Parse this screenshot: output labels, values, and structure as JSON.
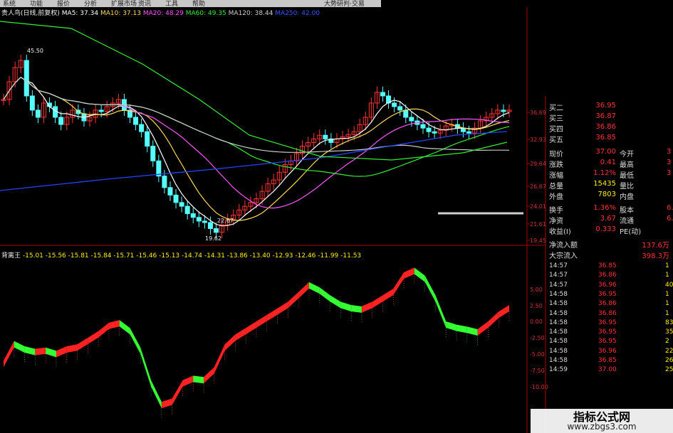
{
  "menu": [
    "系统",
    "功能",
    "报价",
    "分析",
    "扩展市场",
    "资讯",
    "工具",
    "帮助"
  ],
  "menu_right": "大势研判·交易",
  "header": {
    "title": "贵人鸟(日线,前复权)",
    "ma": [
      {
        "label": "MA5: 37.34",
        "color": "#ffffff"
      },
      {
        "label": "MA10: 37.13",
        "color": "#ffdd55"
      },
      {
        "label": "MA20: 48.29",
        "color": "#ff55ff"
      },
      {
        "label": "MA60: 49.35",
        "color": "#33ee33"
      },
      {
        "label": "MA120: 38.44",
        "color": "#cccccc"
      },
      {
        "label": "MA250: 42.00",
        "color": "#3355ff"
      }
    ]
  },
  "price_axis": [
    "36.69",
    "32.93",
    "29.64",
    "26.67",
    "24.01",
    "21.61",
    "19.45"
  ],
  "annotations": {
    "high": "45.50",
    "low": "19.62",
    "mid": "22.67"
  },
  "indicator": {
    "name": "背离王",
    "values": [
      "-15.01",
      "-15.56",
      "-15.81",
      "-15.84",
      "-15.71",
      "-15.46",
      "-15.13",
      "-14.74",
      "-14.31",
      "-13.86",
      "-13.40",
      "-12.93",
      "-12.46",
      "-11.99",
      "-11.53"
    ],
    "axis": [
      "5.00",
      "2.50",
      "0.00",
      "-2.50",
      "-5.00",
      "-7.50",
      "-10.00"
    ]
  },
  "panel": {
    "quotes": [
      {
        "label": "买二",
        "value": "36.95"
      },
      {
        "label": "买三",
        "value": "36.87"
      },
      {
        "label": "买四",
        "value": "36.86"
      },
      {
        "label": "买五",
        "value": "36.85"
      }
    ],
    "stats": [
      {
        "label": "现价",
        "value": "37.00",
        "label2": "今开",
        "value2": "3"
      },
      {
        "label": "涨跌",
        "value": "0.41",
        "label2": "最高",
        "value2": "3"
      },
      {
        "label": "涨幅",
        "value": "1.12%",
        "label2": "最低",
        "value2": "3"
      },
      {
        "label": "总量",
        "value": "15435",
        "label2": "量比",
        "value2": ""
      },
      {
        "label": "外盘",
        "value": "7803",
        "label2": "内盘",
        "value2": ""
      },
      {
        "label": "换手",
        "value": "1.36%",
        "label2": "股本",
        "value2": "6."
      },
      {
        "label": "净资",
        "value": "3.67",
        "label2": "流通",
        "value2": "6."
      },
      {
        "label": "收益(I)",
        "value": "0.333",
        "label2": "PE(动)",
        "value2": ""
      },
      {
        "label": "净流入额",
        "value": "137.6万",
        "label2": "",
        "value2": ""
      },
      {
        "label": "大宗流入",
        "value": "398.3万",
        "label2": "",
        "value2": ""
      }
    ],
    "ticks": [
      {
        "time": "14:57",
        "price": "36.85",
        "vol": "1"
      },
      {
        "time": "14:57",
        "price": "36.86",
        "vol": "1"
      },
      {
        "time": "14:57",
        "price": "36.96",
        "vol": "40"
      },
      {
        "time": "14:58",
        "price": "36.95",
        "vol": "1"
      },
      {
        "time": "14:58",
        "price": "36.86",
        "vol": "1"
      },
      {
        "time": "14:58",
        "price": "36.86",
        "vol": "1"
      },
      {
        "time": "14:58",
        "price": "36.95",
        "vol": "83"
      },
      {
        "time": "14:58",
        "price": "36.95",
        "vol": "35"
      },
      {
        "time": "14:58",
        "price": "36.95",
        "vol": "2"
      },
      {
        "time": "14:58",
        "price": "36.96",
        "vol": "22"
      },
      {
        "time": "14:58",
        "price": "36.85",
        "vol": "26"
      },
      {
        "time": "14:59",
        "price": "37.00",
        "vol": "25"
      }
    ]
  },
  "watermark": {
    "line1": "指标公式网",
    "line2": "www.zbgs3.com"
  }
}
